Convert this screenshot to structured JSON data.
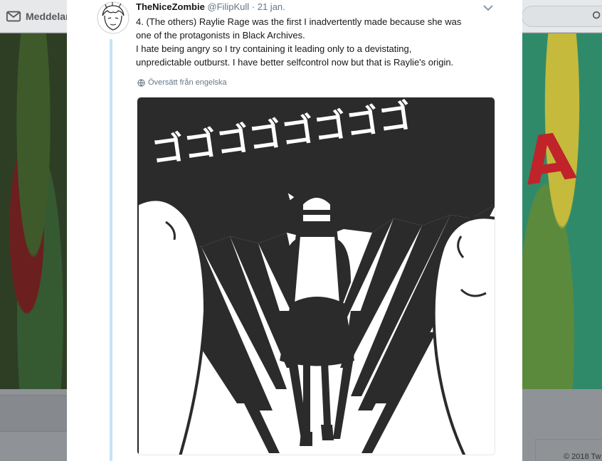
{
  "background": {
    "nav_label": "Meddelan",
    "copyright": "© 2018 Tw"
  },
  "tweet": {
    "display_name": "TheNiceZombie",
    "handle": "@FilipKull",
    "separator": "·",
    "date": "21 jan.",
    "lines": [
      "4. (The others) Raylie Rage was the first I inadvertently made because she was",
      "one of the protagonists in Black Archives.",
      "I hate being angry so I try containing it leading only to a devistating,",
      "unpredictable outburst. I have better selfcontrol now but that is Raylie's origin."
    ],
    "translate_label": "Översätt från engelska"
  },
  "media": {
    "sfx_text": "ゴゴゴゴゴゴゴゴ"
  },
  "colors": {
    "thread_line": "#c4e4f6",
    "link": "#657786",
    "ink": "#2b2b2b"
  },
  "icons": [
    "mail-icon",
    "search-icon",
    "chevron-down-icon",
    "globe-icon"
  ]
}
